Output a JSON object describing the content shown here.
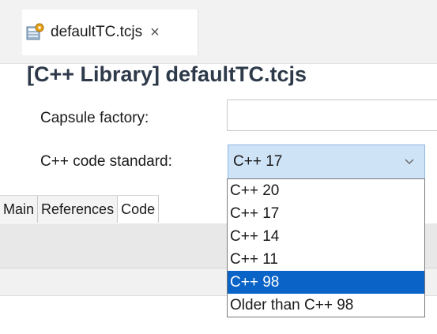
{
  "editor_tab": {
    "label": "defaultTC.tcjs",
    "close_glyph": "×",
    "icon": "tc-file-icon"
  },
  "page_title": "[C++ Library] defaultTC.tcjs",
  "form": {
    "capsule_factory_label": "Capsule factory:",
    "capsule_factory_value": "",
    "code_standard_label": "C++ code standard:",
    "code_standard_value": "C++ 17"
  },
  "dropdown": {
    "options": [
      "C++ 20",
      "C++ 17",
      "C++ 14",
      "C++ 11",
      "C++ 98",
      "Older than C++ 98"
    ],
    "highlighted": "C++ 98",
    "highlight_color": "#0a64c8"
  },
  "page_tabs": {
    "items": [
      "Main",
      "References",
      "Code"
    ],
    "selected": "Code"
  },
  "colors": {
    "title": "#2e3a4a",
    "select_background": "#cfe3f7"
  }
}
